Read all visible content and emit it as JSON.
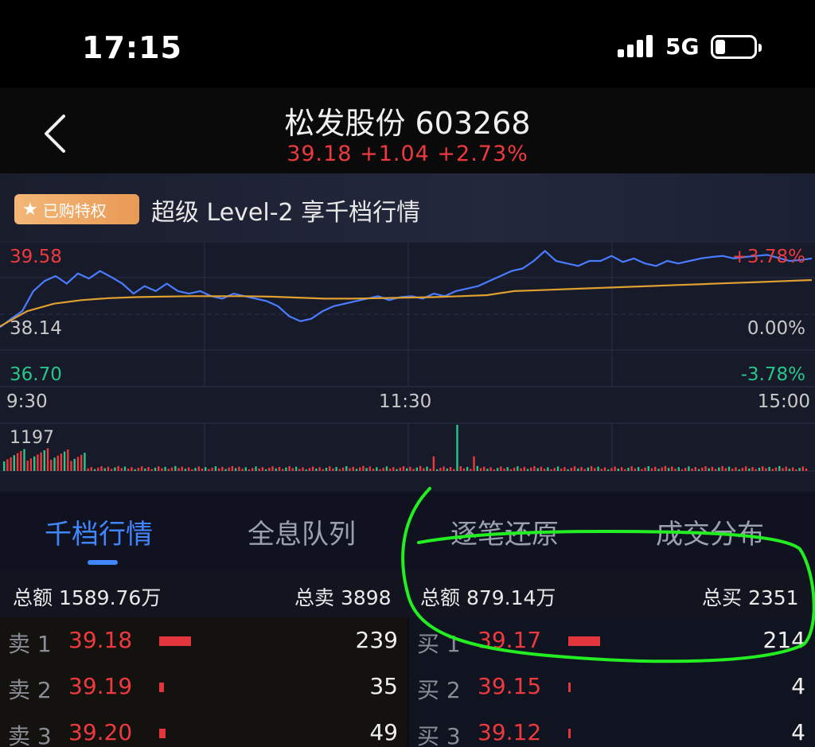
{
  "status_bar": {
    "time": "17:15",
    "network": "5G"
  },
  "header": {
    "title": "松发股份 603268",
    "quote": "39.18 +1.04 +2.73%"
  },
  "banner": {
    "badge": "已购特权",
    "text": "超级 Level-2 享千档行情"
  },
  "chart_labels": {
    "top_price": "39.58",
    "mid_price": "38.14",
    "low_price": "36.70",
    "top_pct": "+3.78%",
    "mid_pct": "0.00%",
    "low_pct": "-3.78%",
    "t_start": "9:30",
    "t_mid": "11:30",
    "t_end": "15:00",
    "vol_max": "1197"
  },
  "tabs": [
    "千档行情",
    "全息队列",
    "逐笔还原",
    "成交分布"
  ],
  "totals": {
    "left_amount": "总额 1589.76万",
    "left_sell": "总卖 3898",
    "right_amount": "总额 879.14万",
    "right_buy": "总买 2351"
  },
  "sell_orders": [
    {
      "label": "卖 1",
      "price": "39.18",
      "qty": "239",
      "bar_ratio": 1.0
    },
    {
      "label": "卖 2",
      "price": "39.19",
      "qty": "35",
      "bar_ratio": 0.15
    },
    {
      "label": "卖 3",
      "price": "39.20",
      "qty": "49",
      "bar_ratio": 0.2
    }
  ],
  "buy_orders": [
    {
      "label": "买 1",
      "price": "39.17",
      "qty": "214",
      "bar_ratio": 1.0
    },
    {
      "label": "买 2",
      "price": "39.15",
      "qty": "4",
      "bar_ratio": 0.08
    },
    {
      "label": "买 3",
      "price": "39.12",
      "qty": "4",
      "bar_ratio": 0.08
    }
  ],
  "colors": {
    "up": "#ee3a3e",
    "down": "#29c68a",
    "price_line": "#4a7cff",
    "avg_line": "#e0a030",
    "annotation": "#22ee22"
  },
  "chart_data": {
    "type": "line",
    "x_ticks": [
      "9:30",
      "11:30",
      "15:00"
    ],
    "ylim": [
      36.7,
      39.58
    ],
    "y_ticks_left": [
      "39.58",
      "38.14",
      "36.70"
    ],
    "y_ticks_right": [
      "+3.78%",
      "0.00%",
      "-3.78%"
    ],
    "series": [
      {
        "values": [
          37.88,
          38.05,
          38.2,
          38.6,
          38.8,
          38.9,
          38.75,
          38.95,
          38.85,
          39.0,
          38.88,
          38.75,
          38.55,
          38.7,
          38.6,
          38.75,
          38.6,
          38.55,
          38.6,
          38.5,
          38.45,
          38.55,
          38.5,
          38.45,
          38.4,
          38.3,
          38.1,
          38.0,
          38.05,
          38.2,
          38.3,
          38.35,
          38.4,
          38.45,
          38.5,
          38.42,
          38.48,
          38.5,
          38.45,
          38.55,
          38.5,
          38.6,
          38.65,
          38.7,
          38.8,
          38.9,
          39.0,
          39.05,
          39.2,
          39.4,
          39.2,
          39.15,
          39.1,
          39.2,
          39.2,
          39.3,
          39.18,
          39.25,
          39.15,
          39.1,
          39.2,
          39.15,
          39.2,
          39.25,
          39.28,
          39.3,
          39.25,
          39.28,
          39.3,
          39.32,
          39.26,
          39.2,
          39.22,
          39.25
        ]
      },
      {
        "values": [
          37.9,
          38.2,
          38.35,
          38.42,
          38.46,
          38.48,
          38.49,
          38.5,
          38.5,
          38.5,
          38.49,
          38.47,
          38.45,
          38.45,
          38.46,
          38.47,
          38.48,
          38.5,
          38.52,
          38.6,
          38.62,
          38.64,
          38.66,
          38.68,
          38.7,
          38.72,
          38.74,
          38.76,
          38.78,
          38.8,
          38.82
        ]
      }
    ],
    "volume": {
      "max_label": "1197",
      "max": 1197
    }
  }
}
